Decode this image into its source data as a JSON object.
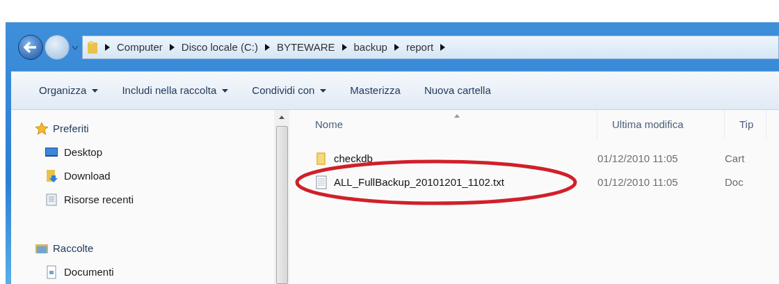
{
  "address_bar": {
    "crumbs": [
      "Computer",
      "Disco locale (C:)",
      "BYTEWARE",
      "backup",
      "report"
    ]
  },
  "toolbar": [
    {
      "label": "Organizza",
      "dropdown": true
    },
    {
      "label": "Includi nella raccolta",
      "dropdown": true
    },
    {
      "label": "Condividi con",
      "dropdown": true
    },
    {
      "label": "Masterizza",
      "dropdown": false
    },
    {
      "label": "Nuova cartella",
      "dropdown": false
    }
  ],
  "sidebar": {
    "groups": [
      {
        "label": "Preferiti",
        "kind": "favorites",
        "children": [
          {
            "label": "Desktop",
            "kind": "desktop"
          },
          {
            "label": "Download",
            "kind": "download"
          },
          {
            "label": "Risorse recenti",
            "kind": "recent"
          }
        ]
      },
      {
        "label": "Raccolte",
        "kind": "libraries",
        "children": [
          {
            "label": "Documenti",
            "kind": "document"
          }
        ]
      }
    ]
  },
  "table": {
    "columns": [
      "Nome",
      "Ultima modifica",
      "Tip"
    ],
    "rows": [
      {
        "kind": "folder",
        "cells": [
          "checkdb",
          "01/12/2010 11:05",
          "Cart"
        ],
        "circled": false
      },
      {
        "kind": "text",
        "cells": [
          "ALL_FullBackup_20101201_1102.txt",
          "01/12/2010 11:05",
          "Doc"
        ],
        "circled": true
      }
    ]
  }
}
